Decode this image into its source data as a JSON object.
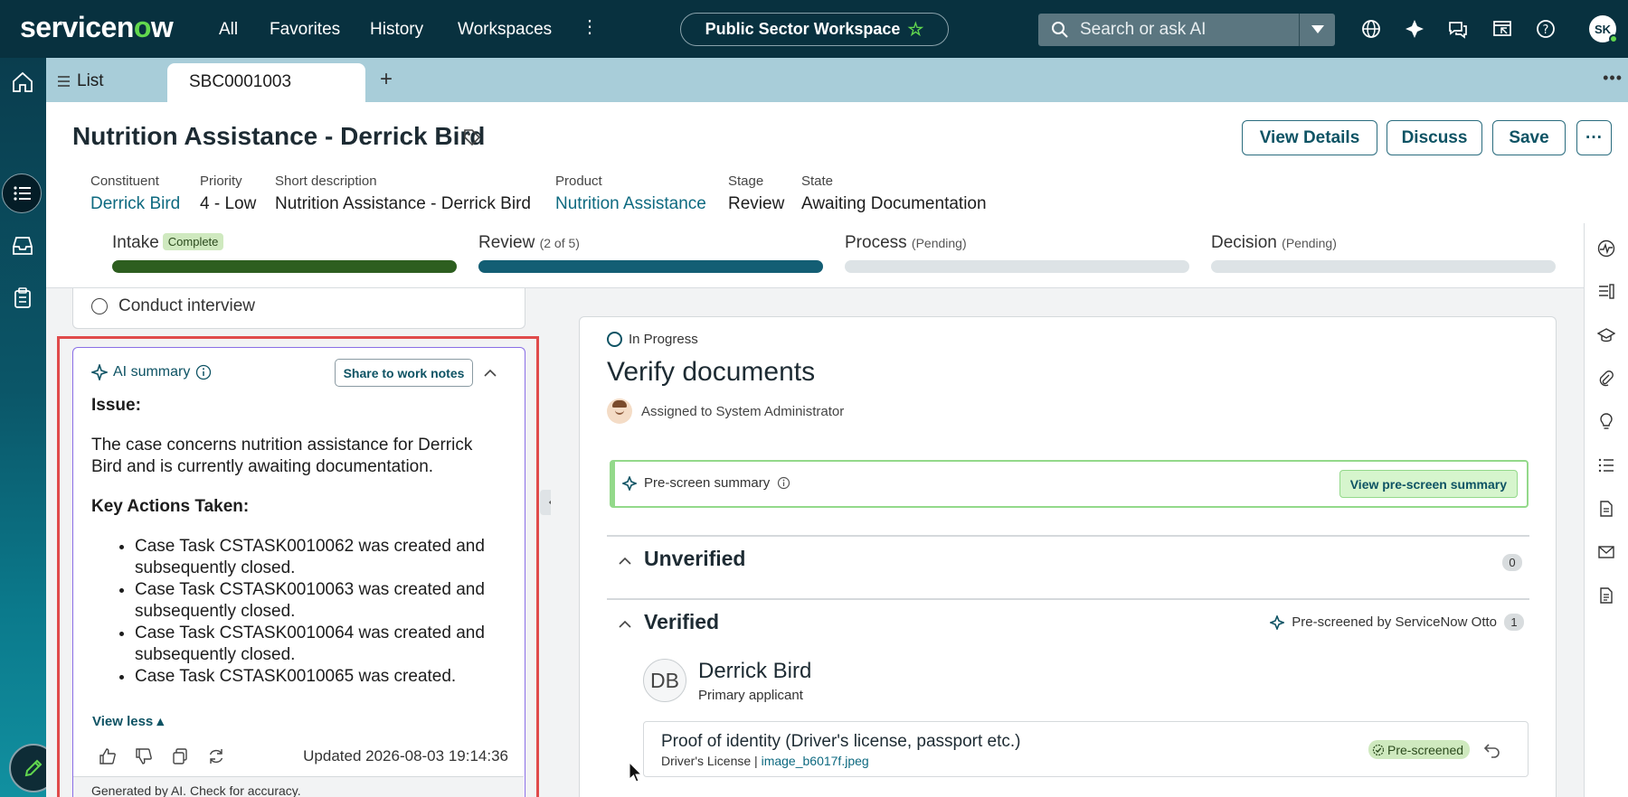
{
  "topnav": {
    "logo_pre": "servicen",
    "logo_o": "o",
    "logo_post": "w",
    "links": [
      "All",
      "Favorites",
      "History",
      "Workspaces"
    ],
    "workspace": "Public Sector Workspace",
    "search_placeholder": "Search or ask AI",
    "avatar_initials": "SK"
  },
  "tabs": {
    "list_label": "List",
    "active_tab": "SBC0001003"
  },
  "record": {
    "title": "Nutrition Assistance - Derrick Bird",
    "buttons": {
      "view_details": "View Details",
      "discuss": "Discuss",
      "save": "Save"
    },
    "fields": [
      {
        "label": "Constituent",
        "value": "Derrick Bird"
      },
      {
        "label": "Priority",
        "value": "4 - Low"
      },
      {
        "label": "Short description",
        "value": "Nutrition Assistance - Derrick Bird"
      },
      {
        "label": "Product",
        "value": "Nutrition Assistance"
      },
      {
        "label": "Stage",
        "value": "Review"
      },
      {
        "label": "State",
        "value": "Awaiting Documentation"
      }
    ]
  },
  "stages": [
    {
      "name": "Intake",
      "badge": "Complete",
      "note": "",
      "fill_fraction": 1.0,
      "color": "#2d5e1f"
    },
    {
      "name": "Review",
      "badge": "",
      "note": "(2 of 5)",
      "fill_fraction": 1.0,
      "color": "#135e74"
    },
    {
      "name": "Process",
      "badge": "",
      "note": "(Pending)",
      "fill_fraction": 0,
      "color": "#dde3e6"
    },
    {
      "name": "Decision",
      "badge": "",
      "note": "(Pending)",
      "fill_fraction": 0,
      "color": "#dde3e6"
    }
  ],
  "checklist": {
    "item": "Conduct interview"
  },
  "ai_summary": {
    "title": "AI summary",
    "share_button": "Share to work notes",
    "issue_heading": "Issue:",
    "issue_text": "The case concerns nutrition assistance for Derrick Bird and is currently awaiting documentation.",
    "actions_heading": "Key Actions Taken:",
    "actions": [
      "Case Task CSTASK0010062 was created and subsequently closed.",
      "Case Task CSTASK0010063 was created and subsequently closed.",
      "Case Task CSTASK0010064 was created and subsequently closed.",
      "Case Task CSTASK0010065 was created."
    ],
    "view_less": "View less",
    "updated": "Updated 2026-08-03 19:14:36",
    "disclaimer": "Generated by AI. Check for accuracy."
  },
  "task": {
    "status": "In Progress",
    "title": "Verify documents",
    "assigned": "Assigned to System Administrator",
    "prescreen_label": "Pre-screen summary",
    "prescreen_button": "View pre-screen summary",
    "unverified_label": "Unverified",
    "unverified_count": "0",
    "verified_label": "Verified",
    "verified_count": "1",
    "otto_label": "Pre-screened by ServiceNow Otto",
    "applicant_initials": "DB",
    "applicant_name": "Derrick Bird",
    "applicant_role": "Primary applicant",
    "doc_title": "Proof of identity (Driver's license, passport etc.)",
    "doc_type": "Driver's License",
    "doc_sep": " | ",
    "doc_file": "image_b6017f.jpeg",
    "doc_badge": "Pre-screened"
  },
  "colors": {
    "nav_bg": "#08313f",
    "accent": "#0e5364",
    "ai_border": "#8a6ee6",
    "highlight": "#e04b4b",
    "success": "#62d84e"
  }
}
